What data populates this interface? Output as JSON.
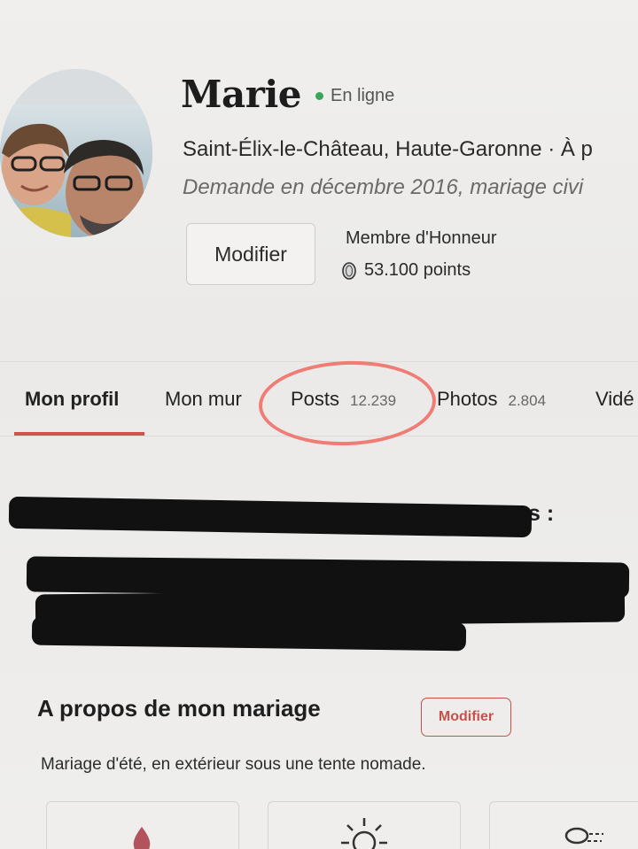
{
  "profile": {
    "name": "Marie",
    "status": "En ligne",
    "location": "Saint-Élix-le-Château, Haute-Garonne · À p",
    "engaged": "Demande en décembre 2016, mariage civi",
    "edit_label": "Modifier",
    "rank": "Membre d'Honneur",
    "points": "53.100 points"
  },
  "tabs": [
    {
      "label": "Mon profil",
      "count": ""
    },
    {
      "label": "Mon mur",
      "count": ""
    },
    {
      "label": "Posts",
      "count": "12.239"
    },
    {
      "label": "Photos",
      "count": "2.804"
    },
    {
      "label": "Vidé",
      "count": ""
    }
  ],
  "member_section": {
    "heading_tail": "s :"
  },
  "about": {
    "title": "A propos de mon mariage",
    "edit_label": "Modifier",
    "description": "Mariage d'été, en extérieur sous une tente nomade."
  },
  "colors": {
    "accent": "#d0524c",
    "online": "#3aa45a",
    "annotation": "#f06a62"
  },
  "icons": [
    "coin-icon",
    "drop-icon",
    "sun-icon",
    "cloud-icon"
  ]
}
